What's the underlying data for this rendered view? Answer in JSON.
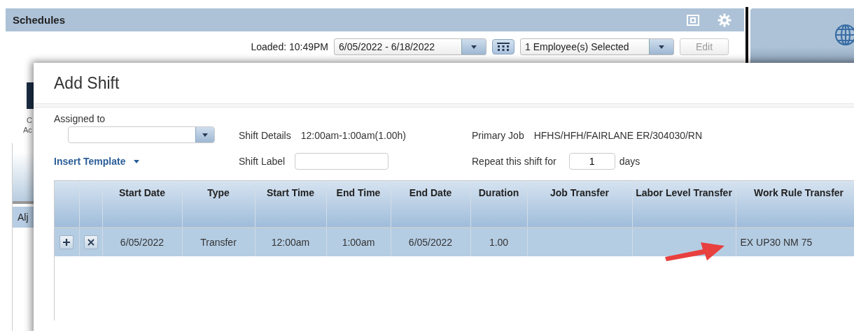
{
  "app": {
    "title": "Schedules",
    "loaded": "Loaded: 10:49PM",
    "date_range": "6/05/2022 - 6/18/2022",
    "employee_select": "1 Employee(s) Selected",
    "edit_button": {
      "label": "Edit",
      "disabled": true
    }
  },
  "background": {
    "fragments": [
      "C",
      "Ac"
    ],
    "list_item": "Alj"
  },
  "dialog": {
    "title": "Add Shift",
    "assigned_label": "Assigned to",
    "shift_details_label": "Shift Details",
    "shift_details": "12:00am-1:00am(1.00h)",
    "primary_job_label": "Primary Job",
    "primary_job": "HFHS/HFH/FAIRLANE ER/304030/RN",
    "insert_template": "Insert Template",
    "shift_label_label": "Shift Label",
    "repeat_label": "Repeat this shift for",
    "repeat_value": "1",
    "repeat_unit": "days"
  },
  "table": {
    "columns": [
      "Start Date",
      "Type",
      "Start Time",
      "End Time",
      "End Date",
      "Duration",
      "Job Transfer",
      "Labor Level Transfer",
      "Work Rule Transfer"
    ],
    "rows": [
      {
        "selected": true,
        "cells": [
          "6/05/2022",
          "Transfer",
          "12:00am",
          "1:00am",
          "6/05/2022",
          "1.00",
          "",
          "",
          "EX UP30 NM 75"
        ]
      }
    ]
  }
}
